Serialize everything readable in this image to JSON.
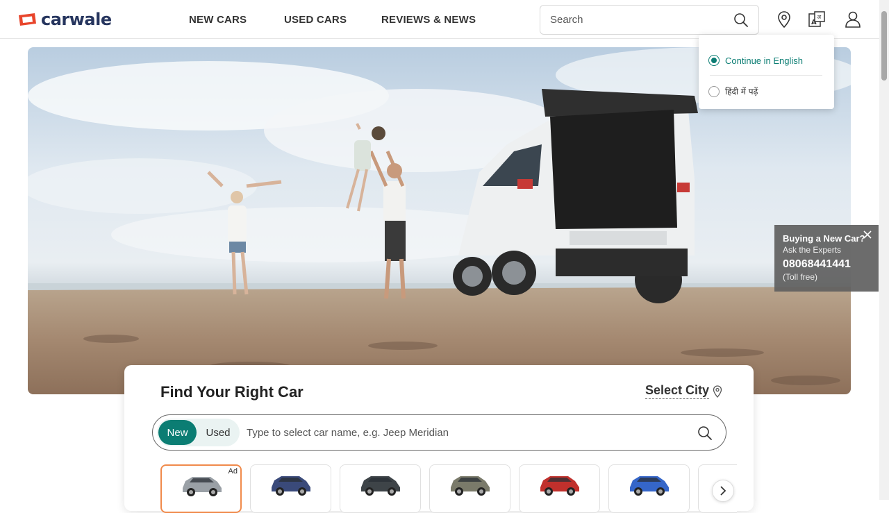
{
  "brand": {
    "name": "carwale",
    "colors": {
      "logo_red": "#e8452c",
      "logo_navy": "#26355e",
      "accent_teal": "#0b7d73"
    }
  },
  "nav": {
    "new_cars": "NEW CARS",
    "used_cars": "USED CARS",
    "reviews_news": "REVIEWS & NEWS"
  },
  "search": {
    "placeholder": "Search",
    "icon": "search-icon"
  },
  "header_icons": [
    "location-pin-icon",
    "language-translate-icon",
    "user-account-icon"
  ],
  "language_menu": {
    "options": [
      {
        "label": "Continue in English",
        "selected": true
      },
      {
        "label": "हिंदी में पढ़ें",
        "selected": false
      }
    ]
  },
  "expert_widget": {
    "title": "Buying a New Car?",
    "subtitle": "Ask the Experts",
    "phone": "08068441441",
    "note": "(Toll free)"
  },
  "finder": {
    "title": "Find Your Right Car",
    "select_city": "Select City",
    "toggle": {
      "new": "New",
      "used": "Used",
      "active": "new"
    },
    "input_placeholder": "Type to select car name, e.g. Jeep Meridian",
    "ad_label": "Ad",
    "car_colors": [
      "#9aa0a6",
      "#3a4a7a",
      "#3e4448",
      "#7a7a6a",
      "#c0302c",
      "#3566c9"
    ]
  }
}
